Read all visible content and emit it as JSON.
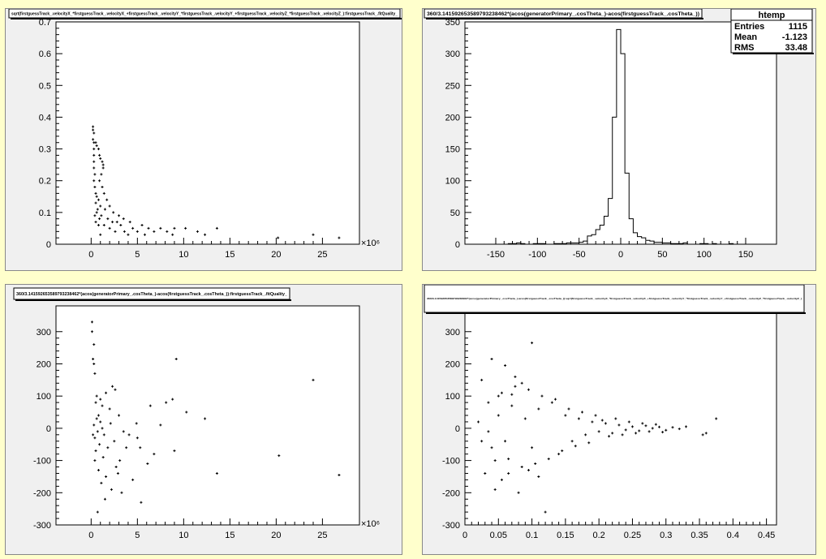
{
  "colors": {
    "canvas": "#ffffcc",
    "pad": "#f0f0f0",
    "frame": "#ffffff",
    "ink": "#000000"
  },
  "chart_data": [
    {
      "type": "scatter",
      "title": "sqrt(firstguessTrack_.velocityX_*firstguessTrack_.velocityX_+firstguessTrack_.velocityY_*firstguessTrack_.velocityY_+firstguessTrack_.velocityZ_*firstguessTrack_.velocityZ_):firstguessTrack_.fitQuality_",
      "xlim": [
        -3.8,
        29
      ],
      "ylim": [
        0,
        0.7
      ],
      "x_ticks": [
        0,
        5,
        10,
        15,
        20,
        25
      ],
      "y_ticks": [
        0,
        0.1,
        0.2,
        0.3,
        0.4,
        0.5,
        0.6,
        0.7
      ],
      "x_exponent": "×10⁶",
      "points": [
        [
          0.2,
          0.37
        ],
        [
          0.2,
          0.36
        ],
        [
          0.3,
          0.35
        ],
        [
          0.2,
          0.33
        ],
        [
          0.3,
          0.32
        ],
        [
          0.5,
          0.32
        ],
        [
          0.6,
          0.31
        ],
        [
          0.3,
          0.3
        ],
        [
          0.8,
          0.3
        ],
        [
          0.3,
          0.28
        ],
        [
          0.9,
          0.28
        ],
        [
          1.0,
          0.27
        ],
        [
          0.3,
          0.26
        ],
        [
          1.2,
          0.26
        ],
        [
          1.3,
          0.25
        ],
        [
          0.3,
          0.24
        ],
        [
          1.3,
          0.24
        ],
        [
          0.4,
          0.22
        ],
        [
          1.1,
          0.22
        ],
        [
          0.3,
          0.2
        ],
        [
          0.9,
          0.2
        ],
        [
          0.4,
          0.18
        ],
        [
          1.2,
          0.18
        ],
        [
          0.5,
          0.16
        ],
        [
          1.4,
          0.16
        ],
        [
          0.6,
          0.15
        ],
        [
          0.8,
          0.14
        ],
        [
          1.7,
          0.14
        ],
        [
          0.5,
          0.13
        ],
        [
          1.0,
          0.12
        ],
        [
          2.0,
          0.12
        ],
        [
          0.7,
          0.11
        ],
        [
          1.5,
          0.11
        ],
        [
          2.4,
          0.1
        ],
        [
          0.6,
          0.1
        ],
        [
          1.1,
          0.09
        ],
        [
          3.0,
          0.09
        ],
        [
          0.9,
          0.08
        ],
        [
          1.8,
          0.08
        ],
        [
          3.5,
          0.08
        ],
        [
          0.5,
          0.07
        ],
        [
          2.3,
          0.07
        ],
        [
          2.8,
          0.07
        ],
        [
          4.2,
          0.07
        ],
        [
          1.4,
          0.06
        ],
        [
          3.2,
          0.06
        ],
        [
          5.5,
          0.06
        ],
        [
          2.0,
          0.05
        ],
        [
          4.5,
          0.05
        ],
        [
          6.2,
          0.05
        ],
        [
          7.5,
          0.05
        ],
        [
          3.6,
          0.04
        ],
        [
          5.0,
          0.04
        ],
        [
          8.2,
          0.04
        ],
        [
          9.0,
          0.05
        ],
        [
          10.2,
          0.05
        ],
        [
          6.8,
          0.04
        ],
        [
          5.8,
          0.03
        ],
        [
          8.8,
          0.03
        ],
        [
          11.5,
          0.04
        ],
        [
          12.3,
          0.03
        ],
        [
          13.6,
          0.05
        ],
        [
          20.2,
          0.02
        ],
        [
          24.0,
          0.03
        ],
        [
          26.8,
          0.02
        ],
        [
          1.0,
          0.03
        ],
        [
          2.6,
          0.04
        ],
        [
          0.4,
          0.09
        ],
        [
          0.8,
          0.06
        ],
        [
          4.0,
          0.03
        ]
      ]
    },
    {
      "type": "bar",
      "title": "360/3.141592653589793238462*(acos(generatorPrimary_.cosTheta_)-acos(firstguessTrack_.cosTheta_))",
      "xlim": [
        -187,
        187
      ],
      "ylim": [
        0,
        350
      ],
      "x_ticks": [
        -150,
        -100,
        -50,
        0,
        50,
        100,
        150
      ],
      "y_ticks": [
        0,
        50,
        100,
        150,
        200,
        250,
        300,
        350
      ],
      "bin_width": 5,
      "bin_start": -180,
      "values": [
        0,
        0,
        0,
        0,
        0,
        0,
        0,
        0,
        0,
        1,
        1,
        2,
        1,
        0,
        0,
        1,
        1,
        1,
        0,
        0,
        1,
        1,
        1,
        2,
        2,
        2,
        3,
        5,
        13,
        15,
        23,
        30,
        44,
        72,
        200,
        338,
        300,
        112,
        40,
        18,
        12,
        10,
        6,
        5,
        3,
        3,
        2,
        2,
        1,
        1,
        1,
        2,
        0,
        0,
        0,
        1,
        1,
        0,
        1,
        0,
        0,
        0,
        1,
        0,
        0,
        0,
        0,
        0,
        0,
        0,
        0,
        0
      ],
      "stats": {
        "title": "htemp",
        "rows": [
          [
            "Entries",
            "1115"
          ],
          [
            "Mean",
            "-1.123"
          ],
          [
            "RMS",
            "33.48"
          ]
        ]
      }
    },
    {
      "type": "scatter",
      "title": "360/3.141592653589793238462*(acos(generatorPrimary_.cosTheta_)-acos(firstguessTrack_.cosTheta_)):firstguessTrack_.fitQuality_",
      "xlim": [
        -3.8,
        29
      ],
      "ylim": [
        -300,
        380
      ],
      "x_ticks": [
        0,
        5,
        10,
        15,
        20,
        25
      ],
      "y_ticks": [
        -300,
        -200,
        -100,
        0,
        100,
        200,
        300
      ],
      "x_exponent": "×10⁶",
      "points": [
        [
          0.1,
          330
        ],
        [
          0.1,
          300
        ],
        [
          0.3,
          260
        ],
        [
          0.2,
          215
        ],
        [
          0.3,
          200
        ],
        [
          0.4,
          170
        ],
        [
          0.6,
          100
        ],
        [
          1.0,
          90
        ],
        [
          1.6,
          110
        ],
        [
          2.3,
          130
        ],
        [
          2.6,
          120
        ],
        [
          0.5,
          80
        ],
        [
          1.2,
          70
        ],
        [
          2.0,
          60
        ],
        [
          3.0,
          40
        ],
        [
          3.5,
          -10
        ],
        [
          4.1,
          -20
        ],
        [
          5.0,
          -30
        ],
        [
          5.3,
          -60
        ],
        [
          6.8,
          -80
        ],
        [
          7.5,
          10
        ],
        [
          8.1,
          80
        ],
        [
          8.8,
          90
        ],
        [
          9.2,
          215
        ],
        [
          10.3,
          50
        ],
        [
          9.0,
          -70
        ],
        [
          12.3,
          30
        ],
        [
          13.6,
          -140
        ],
        [
          20.3,
          -85
        ],
        [
          24.0,
          150
        ],
        [
          26.8,
          -145
        ],
        [
          0.4,
          -100
        ],
        [
          0.8,
          -130
        ],
        [
          1.1,
          -170
        ],
        [
          1.5,
          -220
        ],
        [
          0.7,
          -260
        ],
        [
          2.2,
          -190
        ],
        [
          2.9,
          -140
        ],
        [
          3.3,
          -200
        ],
        [
          4.5,
          -160
        ],
        [
          5.4,
          -230
        ],
        [
          6.1,
          -110
        ],
        [
          0.5,
          -70
        ],
        [
          1.8,
          -60
        ],
        [
          2.5,
          -40
        ],
        [
          1.3,
          -90
        ],
        [
          0.9,
          -50
        ],
        [
          0.4,
          -30
        ],
        [
          0.6,
          30
        ],
        [
          1.0,
          20
        ],
        [
          0.3,
          10
        ],
        [
          0.7,
          -10
        ],
        [
          1.2,
          0
        ],
        [
          0.2,
          -20
        ],
        [
          0.8,
          40
        ],
        [
          1.4,
          -20
        ],
        [
          2.1,
          15
        ],
        [
          3.8,
          -60
        ],
        [
          4.9,
          15
        ],
        [
          6.4,
          70
        ],
        [
          3.1,
          -100
        ],
        [
          2.7,
          -120
        ],
        [
          1.6,
          -150
        ]
      ]
    },
    {
      "type": "scatter",
      "title": "360/3.141592653589793238462*(acos(generatorPrimary_.cosTheta_)-acos(firstguessTrack_.cosTheta_)):sqrt(firstguessTrack_.velocityX_*firstguessTrack_.velocityX_+firstguessTrack_.velocityY_*firstguessTrack_.velocityY_+firstguessTrack_.velocityZ_*firstguessTrack_.velocityZ_)",
      "xlim": [
        0,
        0.465
      ],
      "ylim": [
        -300,
        380
      ],
      "x_ticks": [
        0,
        0.05,
        0.1,
        0.15,
        0.2,
        0.25,
        0.3,
        0.35,
        0.4,
        0.45
      ],
      "y_ticks": [
        -300,
        -200,
        -100,
        0,
        100,
        200,
        300
      ],
      "points": [
        [
          0.025,
          150
        ],
        [
          0.04,
          215
        ],
        [
          0.06,
          195
        ],
        [
          0.075,
          160
        ],
        [
          0.1,
          265
        ],
        [
          0.085,
          140
        ],
        [
          0.07,
          105
        ],
        [
          0.05,
          100
        ],
        [
          0.03,
          -140
        ],
        [
          0.045,
          -190
        ],
        [
          0.055,
          -160
        ],
        [
          0.08,
          -200
        ],
        [
          0.095,
          -130
        ],
        [
          0.11,
          -150
        ],
        [
          0.12,
          -260
        ],
        [
          0.065,
          -95
        ],
        [
          0.04,
          -60
        ],
        [
          0.035,
          -10
        ],
        [
          0.05,
          40
        ],
        [
          0.06,
          -40
        ],
        [
          0.07,
          70
        ],
        [
          0.09,
          30
        ],
        [
          0.1,
          -60
        ],
        [
          0.11,
          60
        ],
        [
          0.13,
          80
        ],
        [
          0.14,
          -80
        ],
        [
          0.15,
          40
        ],
        [
          0.16,
          -40
        ],
        [
          0.17,
          30
        ],
        [
          0.18,
          -20
        ],
        [
          0.19,
          20
        ],
        [
          0.2,
          -10
        ],
        [
          0.21,
          15
        ],
        [
          0.22,
          -15
        ],
        [
          0.23,
          10
        ],
        [
          0.24,
          -5
        ],
        [
          0.25,
          5
        ],
        [
          0.26,
          -8
        ],
        [
          0.27,
          8
        ],
        [
          0.28,
          0
        ],
        [
          0.29,
          4
        ],
        [
          0.3,
          -6
        ],
        [
          0.31,
          3
        ],
        [
          0.32,
          -2
        ],
        [
          0.33,
          5
        ],
        [
          0.355,
          -20
        ],
        [
          0.36,
          -15
        ],
        [
          0.375,
          30
        ],
        [
          0.205,
          25
        ],
        [
          0.215,
          -25
        ],
        [
          0.225,
          30
        ],
        [
          0.235,
          -20
        ],
        [
          0.245,
          20
        ],
        [
          0.255,
          -15
        ],
        [
          0.265,
          15
        ],
        [
          0.275,
          -10
        ],
        [
          0.285,
          12
        ],
        [
          0.295,
          -12
        ],
        [
          0.195,
          40
        ],
        [
          0.185,
          -45
        ],
        [
          0.175,
          50
        ],
        [
          0.165,
          -55
        ],
        [
          0.155,
          60
        ],
        [
          0.145,
          -70
        ],
        [
          0.135,
          90
        ],
        [
          0.125,
          -95
        ],
        [
          0.115,
          100
        ],
        [
          0.105,
          -110
        ],
        [
          0.095,
          120
        ],
        [
          0.085,
          -120
        ],
        [
          0.075,
          130
        ],
        [
          0.065,
          -140
        ],
        [
          0.055,
          110
        ],
        [
          0.045,
          -100
        ],
        [
          0.035,
          80
        ],
        [
          0.025,
          -40
        ],
        [
          0.02,
          20
        ]
      ]
    }
  ]
}
